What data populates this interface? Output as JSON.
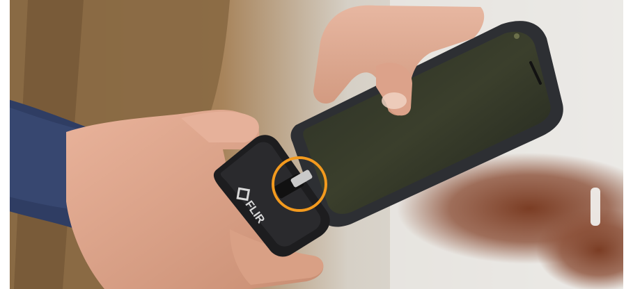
{
  "image": {
    "device_brand": "FLIR",
    "highlight_ring_color": "#F39A1E",
    "objects": [
      "left-hand",
      "thermal-camera-attachment",
      "usb-c-connector",
      "right-hand",
      "smartphone"
    ]
  }
}
